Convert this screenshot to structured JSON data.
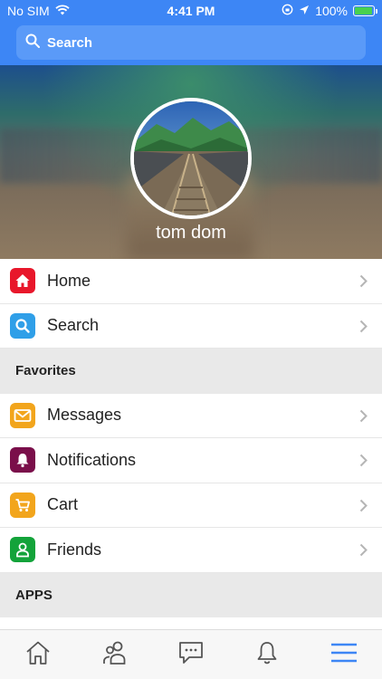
{
  "status": {
    "carrier": "No SIM",
    "time": "4:41 PM",
    "battery": "100%"
  },
  "header": {
    "search_label": "Search"
  },
  "profile": {
    "name": "tom dom"
  },
  "menu": {
    "home": "Home",
    "search": "Search",
    "favorites_header": "Favorites",
    "messages": "Messages",
    "notifications": "Notifications",
    "cart": "Cart",
    "friends": "Friends",
    "apps_header": "APPS"
  },
  "colors": {
    "header_blue": "#3d86f5",
    "home_red": "#e8172b",
    "search_blue": "#2f9fe8",
    "messages_orange": "#f2a51c",
    "notifications_maroon": "#7a0f4a",
    "cart_orange": "#f2a51c",
    "friends_green": "#13a33a",
    "active_tab_blue": "#3d86f5"
  },
  "tabs": [
    "home-icon",
    "friends-icon",
    "chat-icon",
    "bell-icon",
    "menu-icon"
  ]
}
